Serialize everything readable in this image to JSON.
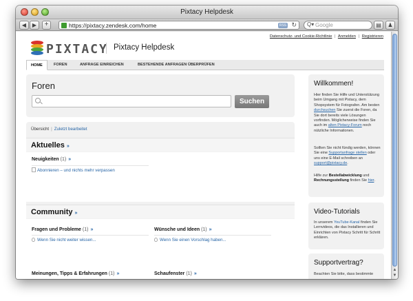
{
  "window": {
    "title": "Pixtacy Helpdesk",
    "url": "https://pixtacy.zendesk.com/home",
    "rss_label": "RSS",
    "search_placeholder": "Google"
  },
  "top_links": {
    "privacy": "Datenschutz- und Cookie-Richtlinie",
    "login": "Anmelden",
    "register": "Registrieren",
    "separator": "|"
  },
  "brand": {
    "wordmark": "PIXTACY",
    "title": "Pixtacy Helpdesk"
  },
  "nav": {
    "tabs": [
      "HOME",
      "FOREN",
      "ANFRAGE EINREICHEN",
      "BESTEHENDE ANFRAGEN ÜBERPRÜFEN"
    ]
  },
  "forums": {
    "title": "Foren",
    "search_button": "Suchen",
    "search_value": ""
  },
  "subnav": {
    "overview": "Übersicht",
    "recent": "Zuletzt bearbeitet",
    "separator": "|"
  },
  "sections": {
    "aktuelles": {
      "title": "Aktuelles",
      "arrow": "»",
      "cat_title": "Neuigkeiten",
      "cat_count": "(1)",
      "cat_arrow": "»",
      "item": "Abonnieren – und nichts mehr verpassen"
    },
    "community": {
      "title": "Community",
      "arrow": "»",
      "cats": [
        {
          "title": "Fragen und Probleme",
          "count": "(1)",
          "arrow": "»",
          "item": "Wenn Sie nicht weiter wissen..."
        },
        {
          "title": "Wünsche und Ideen",
          "count": "(1)",
          "arrow": "»",
          "item": "Wenn Sie einen Vorschlag haben..."
        },
        {
          "title": "Meinungen, Tipps & Erfahrungen",
          "count": "(1)",
          "arrow": "»"
        },
        {
          "title": "Schaufenster",
          "count": "(1)",
          "arrow": "»"
        }
      ]
    }
  },
  "sidebar": {
    "welcome": {
      "title": "Willkommen!",
      "p1_a": "Hier finden Sie Hilfe und Unterstützung beim Umgang mit Pixtacy, dem Shopsystem für Fotografen. Am besten ",
      "p1_link1": "durchsuchen",
      "p1_b": " Sie zuerst die Foren, da Sie dort bereits viele Lösungen vorfinden. Möglicherweise finden Sie auch im ",
      "p1_link2": "alten Pixtacy-Forum",
      "p1_c": " noch nützliche Informationen.",
      "p2_a": "Sollten Sie nicht fündig werden, können Sie eine ",
      "p2_link1": "Supportanfrage stellen",
      "p2_b": " oder uns eine E-Mail schreiben an ",
      "p2_link2": "support@pixtacy.de",
      "p2_c": ".",
      "p3_a": "Hilfe zur ",
      "p3_b1": "Bestellabwicklung",
      "p3_b": " und ",
      "p3_b2": "Rechnungsstellung",
      "p3_c": " finden Sie ",
      "p3_link": "hier",
      "p3_d": "."
    },
    "video": {
      "title": "Video-Tutorials",
      "p_a": "In unserem ",
      "p_link": "YouTube-Kanal",
      "p_b": " finden Sie Lernvideos, die das Installieren und Einrichten von Pixtacy Schritt für Schritt erklären."
    },
    "support": {
      "title": "Supportvertrag?",
      "p": "Beachten Sie bitte, dass bestimmte"
    }
  }
}
